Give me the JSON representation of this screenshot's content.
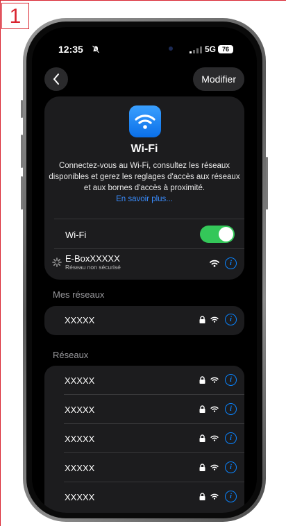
{
  "step_number": "1",
  "status": {
    "time": "12:35",
    "network": "5G",
    "battery": "76"
  },
  "nav": {
    "edit_label": "Modifier"
  },
  "wifi_panel": {
    "title": "Wi-Fi",
    "description": "Connectez-vous au Wi-Fi, consultez les réseaux disponibles et gerez les reglages d'accès aux réseaux et aux bornes d'accès à proximité.",
    "learn_more": "En savoir plus...",
    "toggle_label": "Wi-Fi",
    "toggle_on": true,
    "connecting_network": "E-BoxXXXXX",
    "connecting_network_sub": "Réseau non sécurisé"
  },
  "my_networks": {
    "title": "Mes réseaux",
    "items": [
      {
        "name": "XXXXX"
      }
    ]
  },
  "networks": {
    "title": "Réseaux",
    "items": [
      {
        "name": "XXXXX"
      },
      {
        "name": "XXXXX"
      },
      {
        "name": "XXXXX"
      },
      {
        "name": "XXXXX"
      },
      {
        "name": "XXXXX"
      }
    ]
  },
  "colors": {
    "accent_blue": "#0a84ff",
    "toggle_green": "#34c759",
    "marker_red": "#d9232f"
  }
}
